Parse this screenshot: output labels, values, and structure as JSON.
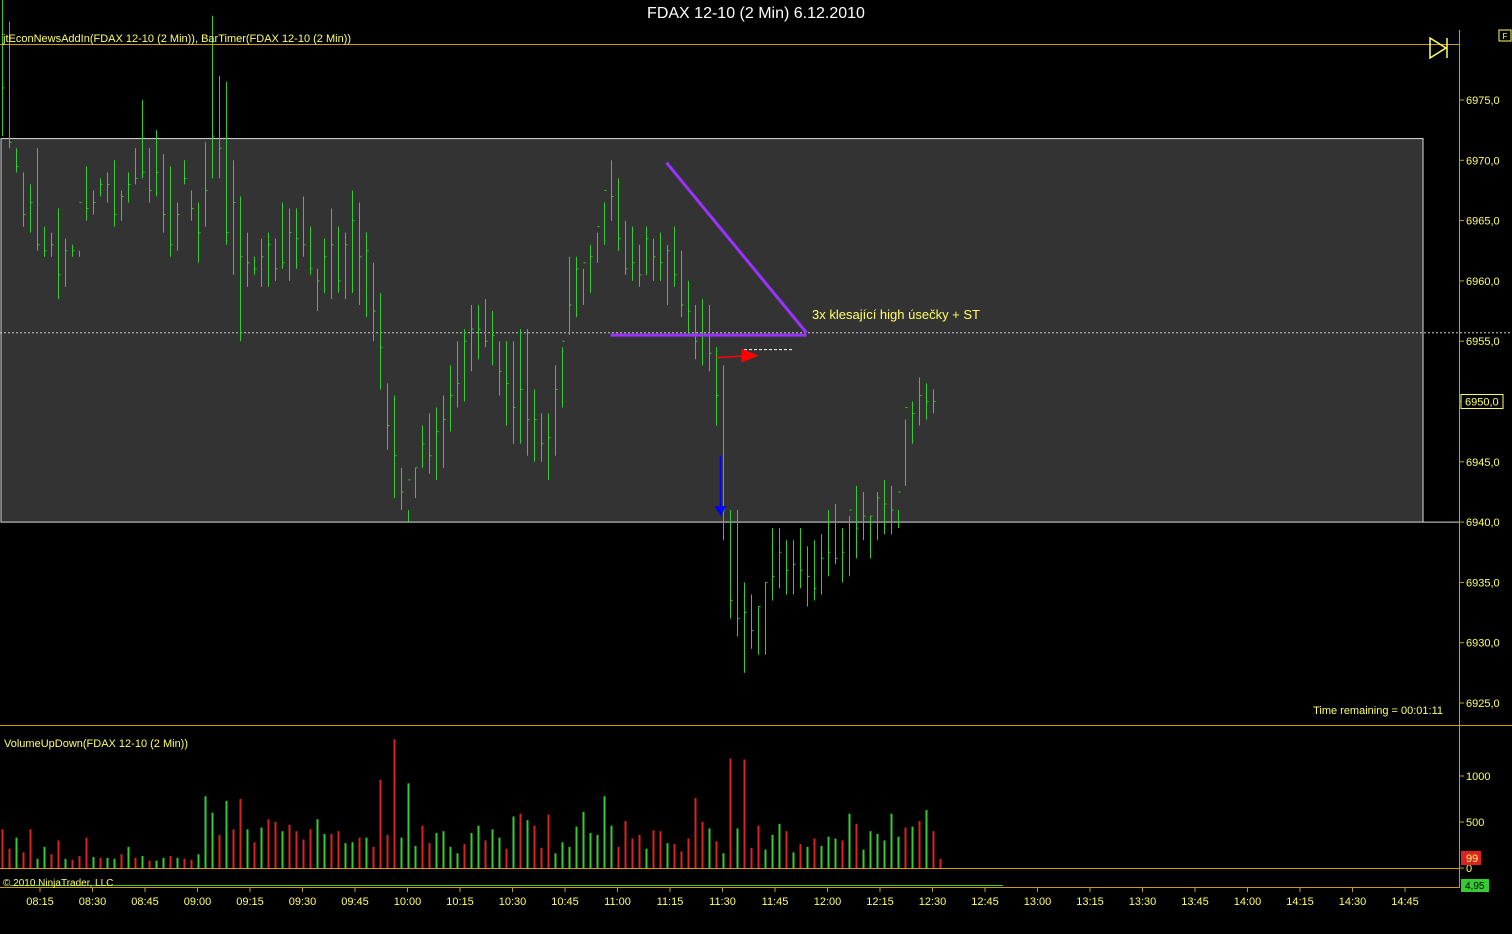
{
  "window": {
    "title": "FDAX 12-10 (2 Min)  6.12.2010"
  },
  "price_panel": {
    "indicator_label": "jtEconNewsAddIn(FDAX 12-10 (2 Min)), BarTimer(FDAX 12-10 (2 Min))",
    "time_remaining": "Time remaining = 00:01:11",
    "annotation": "3x klesající high úsečky + ST",
    "last_price_label": "6950,0",
    "f_button": "F"
  },
  "volume_panel": {
    "indicator_label": "VolumeUpDown(FDAX 12-10 (2 Min))",
    "last_volume_label": "99",
    "bottom_value_label": "4,95"
  },
  "copyright": "© 2010 NinjaTrader, LLC",
  "colors": {
    "price_bar": "#33cc33",
    "volume_up": "#33cc33",
    "volume_down": "#dd2222",
    "zone_fill": "#333333",
    "axis_text": "#ffff66",
    "trendline": "#9933ff",
    "arrow_red": "#ff0000",
    "arrow_blue": "#0000ff"
  },
  "chart_data": [
    {
      "type": "ohlc",
      "name": "price",
      "ylim": [
        6922,
        6988
      ],
      "y_ticks": [
        "6975,0",
        "6970,0",
        "6965,0",
        "6960,0",
        "6955,0",
        "6950,0",
        "6945,0",
        "6940,0",
        "6935,0",
        "6930,0",
        "6925,0"
      ],
      "y_tick_values": [
        6975,
        6970,
        6965,
        6960,
        6955,
        6950,
        6945,
        6940,
        6935,
        6930,
        6925
      ],
      "x_ticks": [
        "08:15",
        "08:30",
        "08:45",
        "09:00",
        "09:15",
        "09:30",
        "09:45",
        "10:00",
        "10:15",
        "10:30",
        "10:45",
        "11:00",
        "11:15",
        "11:30",
        "11:45",
        "12:00",
        "12:15",
        "12:30",
        "12:45",
        "13:00",
        "13:15",
        "13:30",
        "13:45",
        "14:00",
        "14:15",
        "14:30",
        "14:45"
      ],
      "start_time": "08:04",
      "bar_minutes": 2,
      "zone": {
        "top": 6971.8,
        "bottom": 6940.0
      },
      "reference_line": 6955.7,
      "trend_lines": [
        {
          "from": [
            "11:14",
            6969.8
          ],
          "to": [
            "11:54",
            6955.7
          ]
        },
        {
          "from": [
            "10:58",
            6955.5
          ],
          "to": [
            "11:54",
            6955.5
          ]
        }
      ],
      "markers": [
        {
          "type": "arrow-right",
          "time": "11:34",
          "price": 6953.8,
          "color": "red"
        },
        {
          "type": "arrow-down",
          "time": "11:30",
          "price_from": 6945.5,
          "price_to": 6940.5,
          "color": "blue"
        }
      ],
      "highs": [
        6988.0,
        6981.5,
        6971.0,
        6969.0,
        6968.0,
        6971.0,
        6964.5,
        6964.0,
        6966.0,
        6963.5,
        6963.0,
        6962.5,
        6969.5,
        6967.5,
        6968.5,
        6969.0,
        6970.0,
        6967.5,
        6969.0,
        6971.0,
        6975.0,
        6971.0,
        6972.5,
        6970.5,
        6969.5,
        6966.5,
        6970.0,
        6967.5,
        6966.5,
        6971.5,
        6982.0,
        6977.0,
        6976.5,
        6970.0,
        6967.0,
        6964.0,
        6962.0,
        6963.5,
        6964.0,
        6963.5,
        6966.5,
        6966.0,
        6966.0,
        6967.0,
        6964.5,
        6961.0,
        6963.5,
        6966.0,
        6964.5,
        6964.0,
        6967.5,
        6966.5,
        6964.0,
        6961.5,
        6959.0,
        6951.5,
        6950.5,
        6944.5,
        6941.0,
        6944.5,
        6948.0,
        6949.0,
        6949.5,
        6950.5,
        6953.0,
        6955.0,
        6956.0,
        6958.0,
        6958.0,
        6958.5,
        6957.5,
        6955.0,
        6955.0,
        6955.0,
        6956.0,
        6956.0,
        6951.0,
        6949.0,
        6949.0,
        6953.0,
        6954.5,
        6962.0,
        6962.0,
        6961.0,
        6963.0,
        6964.0,
        6966.5,
        6970.0,
        6968.5,
        6965.0,
        6964.5,
        6963.0,
        6964.5,
        6963.5,
        6964.0,
        6963.0,
        6964.5,
        6962.5,
        6960.0,
        6958.0,
        6958.5,
        6958.0,
        6954.5,
        6953.0,
        6941.0,
        6941.0,
        6935.0,
        6934.0,
        6933.0,
        6935.0,
        6939.5,
        6939.5,
        6938.5,
        6938.5,
        6939.5,
        6938.0,
        6938.5,
        6939.0,
        6941.0,
        6941.5,
        6939.5,
        6940.5,
        6943.0,
        6942.5,
        6940.5,
        6942.5,
        6943.5,
        6943.0,
        6941.0,
        6948.5,
        6950.0,
        6952.0,
        6951.5,
        6951.0
      ],
      "lows": [
        6972.0,
        6971.0,
        6969.0,
        6964.5,
        6964.0,
        6962.5,
        6962.0,
        6962.0,
        6958.5,
        6959.5,
        6962.0,
        6962.0,
        6965.0,
        6965.5,
        6967.0,
        6966.5,
        6964.5,
        6965.0,
        6966.5,
        6968.0,
        6968.5,
        6966.5,
        6967.0,
        6964.0,
        6962.0,
        6962.5,
        6968.0,
        6965.0,
        6961.5,
        6964.5,
        6968.5,
        6968.5,
        6963.0,
        6960.5,
        6955.0,
        6959.5,
        6960.5,
        6959.5,
        6959.5,
        6960.0,
        6961.0,
        6960.0,
        6961.0,
        6962.0,
        6960.5,
        6957.5,
        6959.0,
        6958.5,
        6959.0,
        6958.5,
        6959.0,
        6958.0,
        6957.0,
        6955.0,
        6951.0,
        6946.0,
        6942.0,
        6941.0,
        6940.0,
        6942.0,
        6944.5,
        6944.0,
        6943.5,
        6944.5,
        6947.5,
        6949.5,
        6950.0,
        6952.5,
        6953.5,
        6954.5,
        6953.0,
        6950.5,
        6948.0,
        6946.5,
        6946.5,
        6945.5,
        6945.0,
        6945.0,
        6943.5,
        6945.5,
        6949.5,
        6955.5,
        6957.0,
        6958.0,
        6959.0,
        6961.5,
        6963.0,
        6965.0,
        6962.5,
        6960.5,
        6960.0,
        6959.5,
        6960.5,
        6960.0,
        6960.0,
        6958.0,
        6959.5,
        6957.0,
        6955.5,
        6953.5,
        6953.0,
        6952.5,
        6948.0,
        6938.5,
        6932.0,
        6930.5,
        6927.5,
        6929.5,
        6929.0,
        6929.0,
        6933.5,
        6934.5,
        6934.0,
        6934.0,
        6934.5,
        6933.0,
        6933.5,
        6934.0,
        6935.5,
        6936.5,
        6935.0,
        6935.5,
        6937.0,
        6938.5,
        6937.0,
        6938.5,
        6939.0,
        6939.0,
        6939.5,
        6943.0,
        6946.5,
        6948.0,
        6948.5,
        6949.0
      ],
      "closes": [
        6976.0,
        6971.5,
        6969.5,
        6965.5,
        6966.5,
        6963.0,
        6962.5,
        6963.0,
        6960.5,
        6962.5,
        6962.5,
        6966.5,
        6966.0,
        6966.5,
        6968.0,
        6968.0,
        6965.5,
        6967.0,
        6968.0,
        6968.5,
        6969.0,
        6967.5,
        6969.0,
        6965.5,
        6963.0,
        6965.5,
        6968.5,
        6966.0,
        6964.0,
        6967.5,
        6972.0,
        6971.0,
        6964.0,
        6966.5,
        6962.0,
        6961.5,
        6961.0,
        6962.0,
        6963.0,
        6961.0,
        6961.5,
        6964.0,
        6963.5,
        6963.0,
        6961.0,
        6960.0,
        6962.0,
        6963.0,
        6960.0,
        6963.0,
        6965.0,
        6962.0,
        6962.5,
        6957.5,
        6954.5,
        6948.0,
        6945.5,
        6942.5,
        6943.5,
        6944.5,
        6946.5,
        6945.5,
        6947.5,
        6948.5,
        6950.5,
        6951.5,
        6955.0,
        6956.0,
        6956.0,
        6955.0,
        6955.5,
        6952.5,
        6951.5,
        6949.5,
        6951.0,
        6948.5,
        6948.5,
        6946.5,
        6947.0,
        6951.0,
        6955.0,
        6958.0,
        6961.0,
        6961.5,
        6962.0,
        6964.5,
        6967.5,
        6967.0,
        6963.5,
        6961.0,
        6961.5,
        6960.5,
        6963.5,
        6962.0,
        6961.5,
        6962.5,
        6960.5,
        6958.0,
        6957.5,
        6955.0,
        6955.5,
        6954.0,
        6950.5,
        6941.0,
        6933.5,
        6932.0,
        6932.5,
        6931.0,
        6933.0,
        6935.0,
        6935.5,
        6937.5,
        6936.0,
        6936.5,
        6936.0,
        6935.5,
        6934.5,
        6937.0,
        6937.5,
        6937.0,
        6937.5,
        6941.0,
        6939.5,
        6940.5,
        6940.5,
        6942.0,
        6941.5,
        6941.0,
        6942.5,
        6949.5,
        6949.0,
        6950.5,
        6950.0,
        6950.0
      ]
    },
    {
      "type": "bar",
      "name": "volume",
      "ylim": [
        0,
        1400
      ],
      "y_ticks": [
        "1000",
        "500",
        "0"
      ],
      "y_tick_values": [
        1000,
        500,
        0
      ],
      "volumes": [
        420,
        210,
        330,
        170,
        420,
        100,
        230,
        150,
        300,
        100,
        90,
        130,
        330,
        120,
        110,
        110,
        100,
        150,
        230,
        110,
        130,
        80,
        80,
        110,
        130,
        110,
        100,
        90,
        150,
        780,
        600,
        360,
        730,
        420,
        750,
        420,
        280,
        440,
        530,
        500,
        400,
        470,
        400,
        310,
        420,
        530,
        370,
        370,
        400,
        270,
        280,
        330,
        330,
        230,
        960,
        360,
        1400,
        330,
        920,
        240,
        460,
        270,
        380,
        400,
        230,
        160,
        260,
        380,
        460,
        300,
        420,
        330,
        210,
        560,
        590,
        520,
        460,
        220,
        580,
        160,
        280,
        230,
        450,
        610,
        380,
        360,
        780,
        460,
        230,
        510,
        320,
        360,
        210,
        410,
        400,
        270,
        260,
        180,
        320,
        760,
        500,
        430,
        290,
        160,
        1190,
        430,
        1180,
        220,
        460,
        200,
        360,
        480,
        400,
        170,
        260,
        230,
        320,
        240,
        340,
        320,
        300,
        590,
        480,
        200,
        400,
        370,
        300,
        590,
        340,
        440,
        450,
        510,
        630,
        400,
        100
      ],
      "up": [
        false,
        false,
        true,
        false,
        false,
        true,
        true,
        false,
        false,
        true,
        false,
        false,
        false,
        true,
        false,
        true,
        true,
        false,
        true,
        false,
        true,
        false,
        true,
        true,
        false,
        true,
        false,
        false,
        true,
        true,
        true,
        false,
        true,
        false,
        false,
        true,
        false,
        true,
        false,
        false,
        true,
        false,
        false,
        false,
        false,
        true,
        true,
        false,
        false,
        true,
        true,
        false,
        true,
        false,
        false,
        false,
        false,
        true,
        true,
        true,
        false,
        false,
        true,
        true,
        true,
        true,
        false,
        true,
        true,
        false,
        true,
        true,
        false,
        true,
        false,
        true,
        false,
        false,
        false,
        true,
        true,
        true,
        true,
        true,
        true,
        true,
        true,
        true,
        false,
        false,
        false,
        false,
        true,
        false,
        false,
        true,
        false,
        false,
        false,
        false,
        false,
        true,
        false,
        true,
        false,
        true,
        false,
        false,
        false,
        true,
        true,
        true,
        false,
        true,
        false,
        true,
        false,
        true,
        true,
        true,
        false,
        true,
        false,
        true,
        true,
        true,
        true,
        true,
        true,
        false,
        true,
        false,
        true,
        false,
        false,
        true,
        false
      ]
    }
  ]
}
